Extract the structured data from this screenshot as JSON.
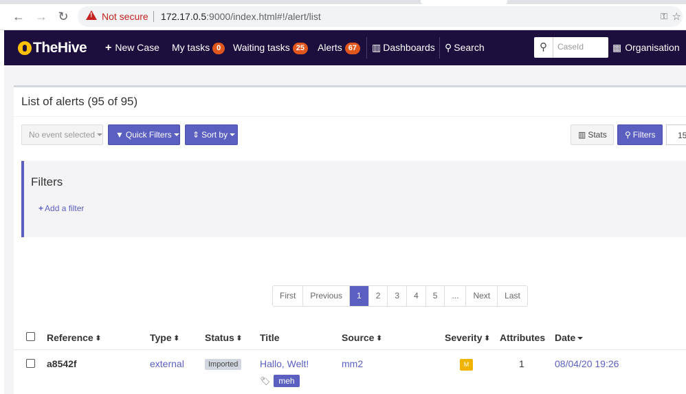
{
  "browser": {
    "security_label": "Not secure",
    "url_host": "172.17.0.5",
    "url_rest": ":9000/index.html#!/alert/list"
  },
  "navbar": {
    "brand": "TheHive",
    "new_case": "New Case",
    "my_tasks": "My tasks",
    "my_tasks_count": "0",
    "waiting_tasks": "Waiting tasks",
    "waiting_tasks_count": "25",
    "alerts": "Alerts",
    "alerts_count": "67",
    "dashboards": "Dashboards",
    "search": "Search",
    "caseid_placeholder": "CaseId",
    "organisation": "Organisation",
    "badge_color": "#e0561c"
  },
  "panel": {
    "title": "List of alerts (95 of 95)",
    "no_event_selected": "No event selected",
    "quick_filters": "Quick Filters",
    "sort_by": "Sort by",
    "stats": "Stats",
    "filters_button": "Filters",
    "page_size": "15",
    "filters_title": "Filters",
    "add_filter": "Add a filter",
    "accent_color": "#5a5fc0"
  },
  "pagination": [
    "First",
    "Previous",
    "1",
    "2",
    "3",
    "4",
    "5",
    "...",
    "Next",
    "Last"
  ],
  "pagination_active": "1",
  "table": {
    "headers": {
      "reference": "Reference",
      "type": "Type",
      "status": "Status",
      "title": "Title",
      "source": "Source",
      "severity": "Severity",
      "attributes": "Attributes",
      "date": "Date"
    },
    "rows": [
      {
        "reference": "a8542f",
        "type": "external",
        "status": "Imported",
        "title": "Hallo, Welt!",
        "tag": "meh",
        "source": "mm2",
        "severity": "M",
        "attributes": "1",
        "date": "08/04/20 19:26"
      }
    ]
  }
}
